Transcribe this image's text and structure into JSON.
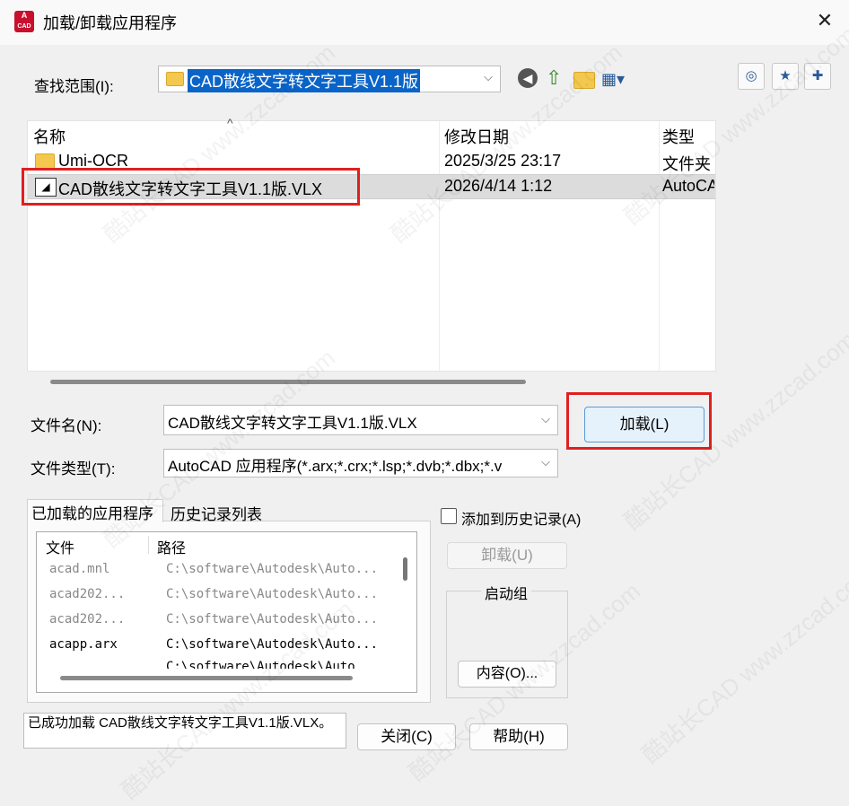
{
  "window": {
    "title": "加载/卸载应用程序",
    "app_icon_text": "CAD"
  },
  "lookin": {
    "label": "查找范围(I):",
    "value": "CAD散线文字转文字工具V1.1版"
  },
  "columns": {
    "name": "名称",
    "date": "修改日期",
    "type": "类型"
  },
  "files": [
    {
      "name": "Umi-OCR",
      "date": "2025/3/25 23:17",
      "type": "文件夹",
      "kind": "folder"
    },
    {
      "name": "CAD散线文字转文字工具V1.1版.VLX",
      "date": "2026/4/14 1:12",
      "type": "AutoCAD",
      "kind": "vlx",
      "selected": true
    }
  ],
  "filename": {
    "label": "文件名(N):",
    "value": "CAD散线文字转文字工具V1.1版.VLX"
  },
  "filetype": {
    "label": "文件类型(T):",
    "value": "AutoCAD 应用程序(*.arx;*.crx;*.lsp;*.dvb;*.dbx;*.v"
  },
  "buttons": {
    "load": "加载(L)",
    "unload": "卸载(U)",
    "contents": "内容(O)...",
    "close": "关闭(C)",
    "help": "帮助(H)"
  },
  "tabs": {
    "loaded": "已加载的应用程序",
    "history": "历史记录列表"
  },
  "loaded_cols": {
    "file": "文件",
    "path": "路径"
  },
  "loaded_apps": [
    {
      "file": "acad.mnl",
      "path": "C:\\software\\Autodesk\\Auto...",
      "dim": true
    },
    {
      "file": "acad202...",
      "path": "C:\\software\\Autodesk\\Auto...",
      "dim": true
    },
    {
      "file": "acad202...",
      "path": "C:\\software\\Autodesk\\Auto...",
      "dim": true
    },
    {
      "file": "acapp.arx",
      "path": "C:\\software\\Autodesk\\Auto...",
      "dim": false
    }
  ],
  "partial_row": "C:\\software\\Autodesk\\Auto",
  "history_checkbox": {
    "label": "添加到历史记录(A)",
    "checked": false
  },
  "startup": {
    "label": "启动组"
  },
  "status": "已成功加载 CAD散线文字转文字工具V1.1版.VLX。",
  "watermark": "酷站长CAD www.zzcad.com"
}
